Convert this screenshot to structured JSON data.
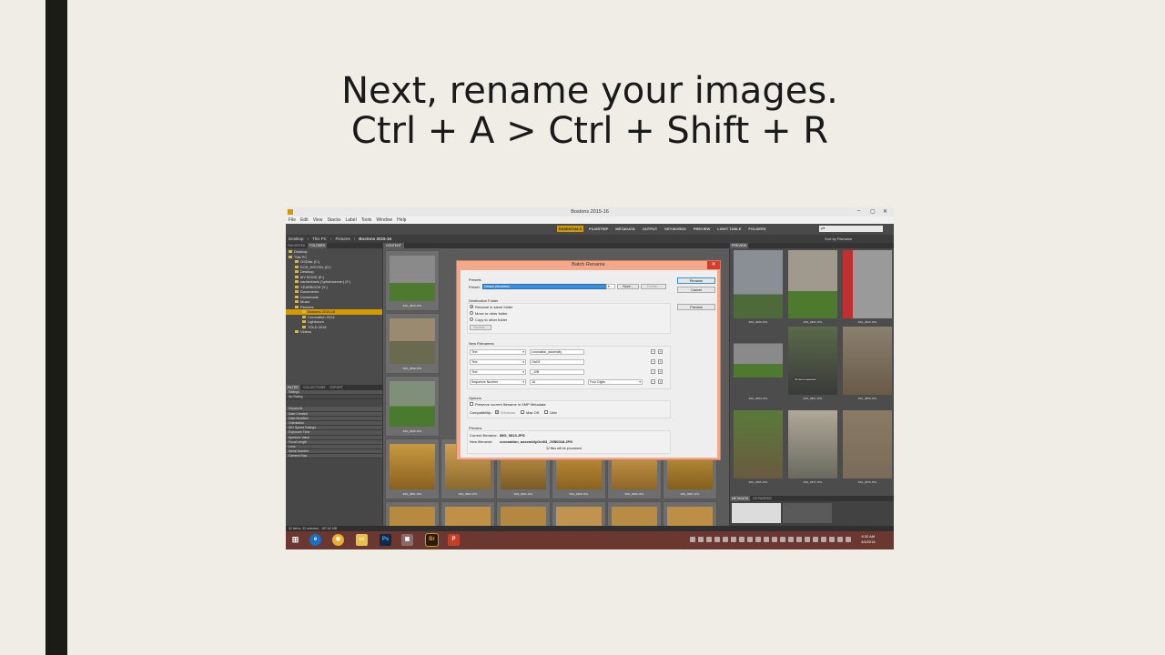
{
  "slide": {
    "title_line1": "Next, rename your images.",
    "title_line2": "Ctrl + A > Ctrl + Shift + R"
  },
  "window": {
    "title": "Bostons 2015-16",
    "menu": [
      "File",
      "Edit",
      "View",
      "Stacks",
      "Label",
      "Tools",
      "Window",
      "Help"
    ]
  },
  "workspaces": [
    "ESSENTIALS",
    "FILMSTRIP",
    "METADATA",
    "OUTPUT",
    "KEYWORDS",
    "PREVIEW",
    "LIGHT TABLE",
    "FOLDERS"
  ],
  "search_placeholder": "ρ▾",
  "path": [
    "Desktop",
    "This PC",
    "Pictures",
    "Bostons 2015-16"
  ],
  "sort_label": "Sort by Filename",
  "left_tabs": [
    "FAVORITES",
    "FOLDERS"
  ],
  "folders": [
    "Desktop",
    "This PC",
    "OSDisk (C:)",
    "EOS_DIGITAL (D:)",
    "Desktop",
    "MY BOOK (E:)",
    "canberbaris (\\\\photoserver) (F:)",
    "YEARBOOK (Y:)",
    "Documents",
    "Downloads",
    "Music",
    "Pictures",
    "Bostons 2015-16",
    "Coronation 2014",
    "Lightroom",
    "TOLD 2016",
    "Videos"
  ],
  "filter_tabs": [
    "FILTER",
    "COLLECTIONS",
    "EXPORT"
  ],
  "filters": [
    "Ratings",
    "No Rating",
    "Keywords",
    "Date Created",
    "Date Modified",
    "Orientation",
    "ISO Speed Ratings",
    "Exposure Time",
    "Aperture Value",
    "Focal Length",
    "Lens",
    "Serial Number",
    "Camera Raw"
  ],
  "content_tab": "CONTENT",
  "thumbs": [
    {
      "cap": "IMG_0813.JPG"
    },
    {
      "cap": "IMG_0838.JPG"
    },
    {
      "cap": "IMG_0845.JPG"
    },
    {
      "cap": "IMG_0861.JPG"
    },
    {
      "cap": "IMG_0863.JPG"
    },
    {
      "cap": "IMG_0901.JPG"
    },
    {
      "cap": "IMG_0905.JPG"
    },
    {
      "cap": "IMG_0906.JPG"
    },
    {
      "cap": "IMG_0907.JPG"
    }
  ],
  "preview_tab": "PREVIEW",
  "preview_badge": "32 items selected",
  "preview_caps": [
    "IMG_0826.JPG",
    "IMG_0841.JPG",
    "IMG_0843.JPG",
    "IMG_0854.JPG",
    "IMG_0857.JPG",
    "IMG_0860.JPG",
    "IMG_0865.JPG",
    "IMG_0871.JPG",
    "IMG_0876.JPG"
  ],
  "meta_tabs": [
    "METADATA",
    "KEYWORDS"
  ],
  "status": "32 items, 32 selected - 187.62 MB",
  "clock": {
    "time": "6:32 AM",
    "date": "3/4/2016"
  },
  "dialog": {
    "title": "Batch Rename",
    "presets_label": "Presets",
    "preset_label": "Preset:",
    "preset_value": "Default (Modified)",
    "save_btn": "Save...",
    "delete_btn": "Delete...",
    "rename_btn": "Rename",
    "cancel_btn": "Cancel",
    "preview_btn": "Preview",
    "dest_label": "Destination Folder",
    "dest_options": [
      "Rename in same folder",
      "Move to other folder",
      "Copy to other folder"
    ],
    "browse_btn": "Browse...",
    "newnames_label": "New Filenames",
    "rows": [
      {
        "type": "Text",
        "value": "coronation_assembly",
        "extra": ""
      },
      {
        "type": "Text",
        "value": "Oct03",
        "extra": ""
      },
      {
        "type": "Text",
        "value": "_JVB",
        "extra": ""
      },
      {
        "type": "Sequence Number",
        "value": "18",
        "extra": "Four Digits"
      }
    ],
    "options_label": "Options",
    "preserve_label": "Preserve current filename in XMP Metadata",
    "compat_label": "Compatibility:",
    "compat_options": [
      "Windows",
      "Mac OS",
      "Unix"
    ],
    "preview_label": "Preview",
    "current_label": "Current filename:",
    "current_value": "IMG_0813.JPG",
    "new_label": "New filename:",
    "new_value": "coronation_assemblyOct03_JVB0018.JPG",
    "files_note": "32 files will be processed"
  },
  "colors": {
    "accent": "#d29a00",
    "dialog_frame": "#f5a889",
    "taskbar": "#6a3830"
  }
}
